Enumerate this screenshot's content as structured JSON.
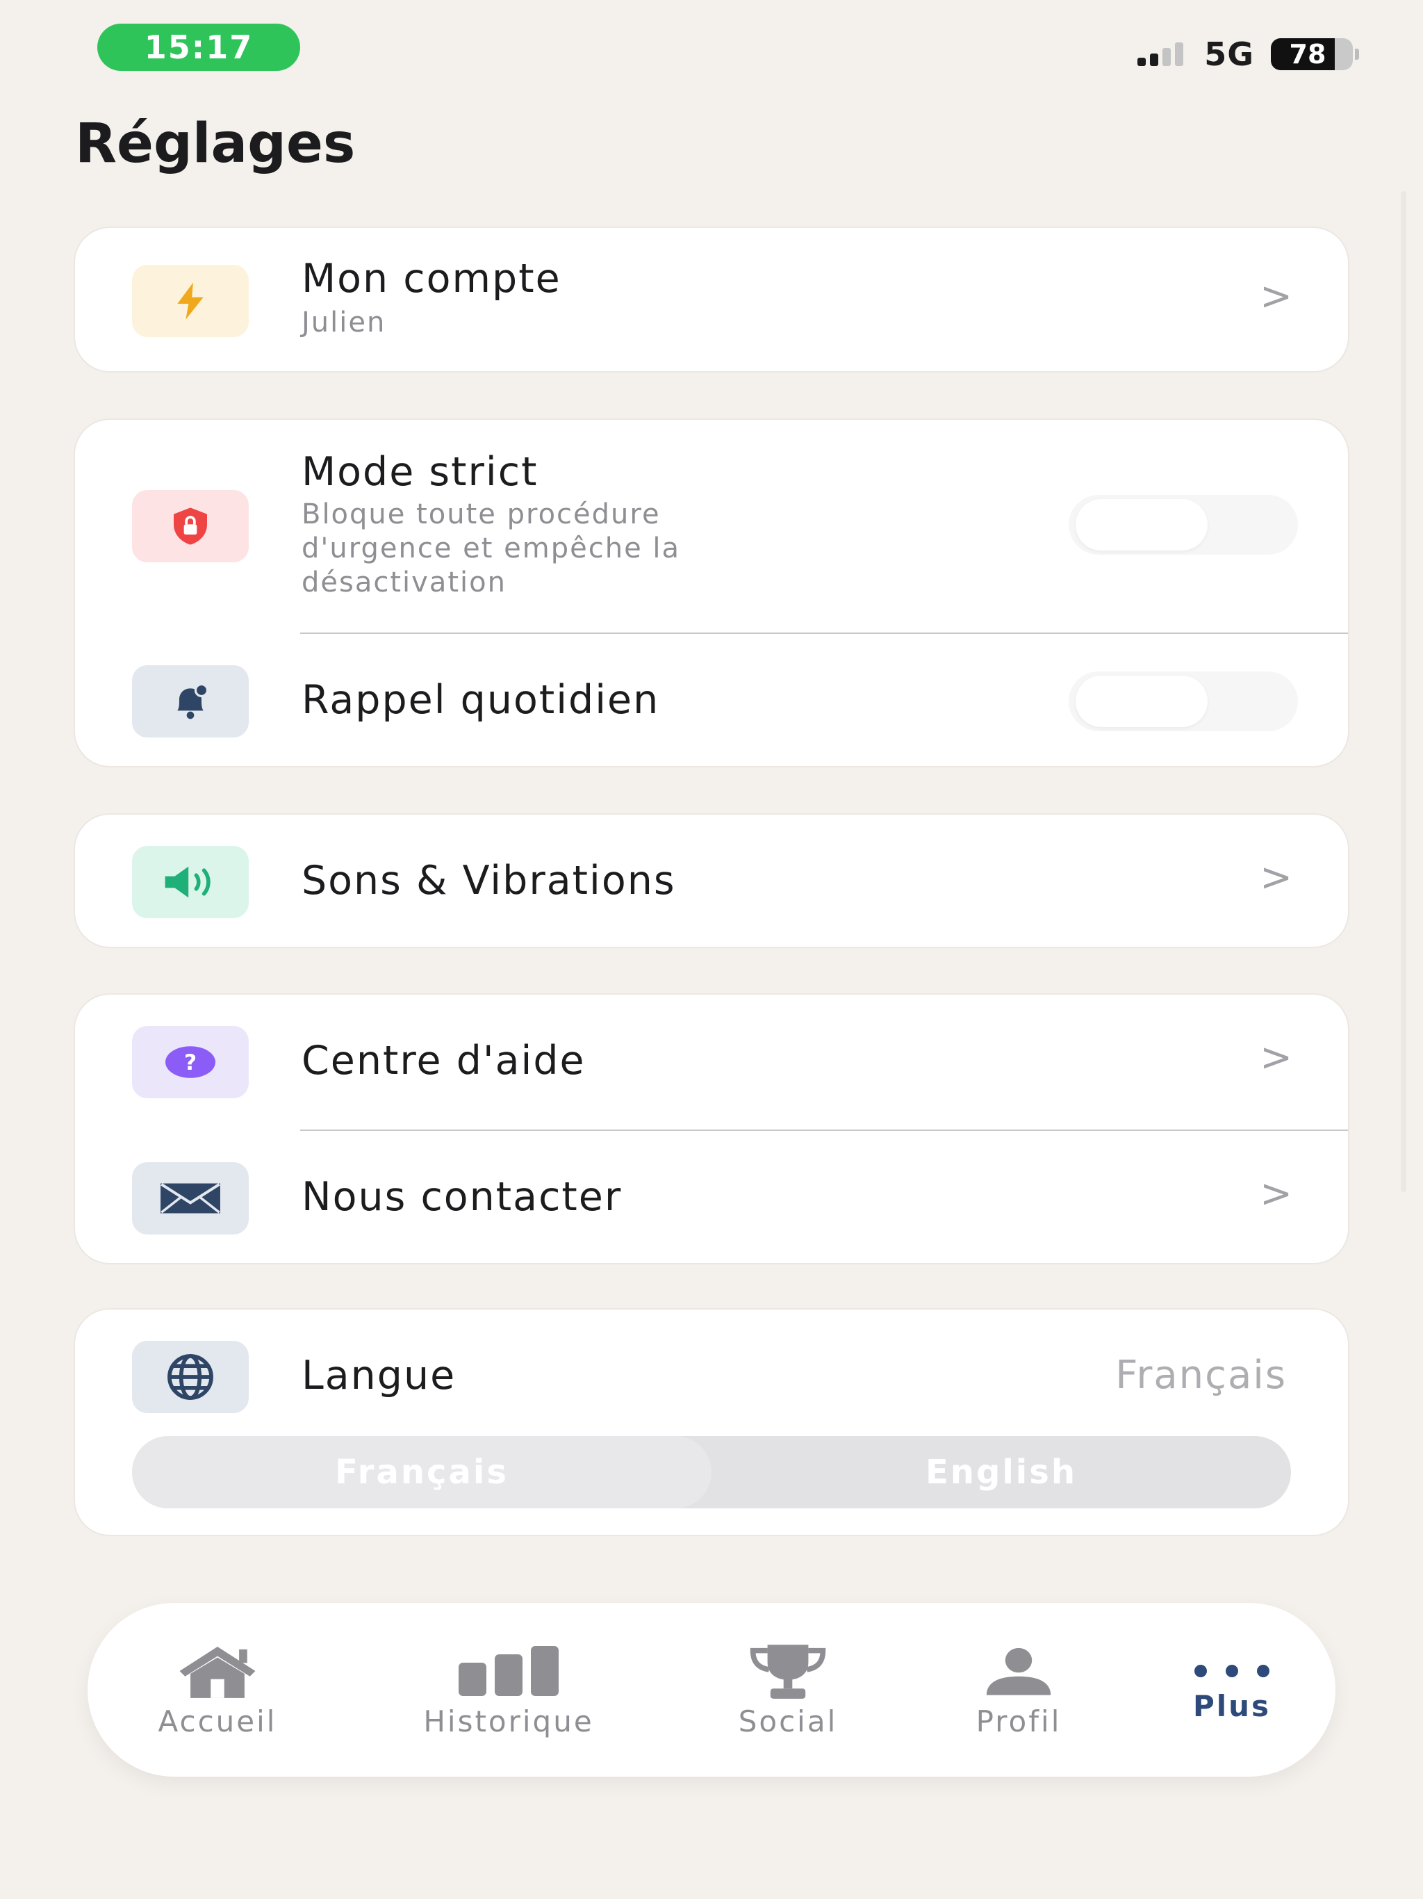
{
  "status_bar": {
    "time": "15:17",
    "network": "5G",
    "battery_percent": "78",
    "time_pill_color": "#2fc45a"
  },
  "page": {
    "title": "Réglages"
  },
  "sections": {
    "account": {
      "title": "Mon compte",
      "subtitle": "Julien",
      "icon": "bolt-icon",
      "icon_bg": "#fdf3dd"
    },
    "strict_mode": {
      "title": "Mode strict",
      "subtitle_lines": [
        "Bloque toute procédure",
        "d'urgence et empêche la",
        "désactivation"
      ],
      "icon": "shield-lock-icon",
      "icon_bg": "#fde3e3",
      "enabled": false
    },
    "daily_reminder": {
      "title": "Rappel quotidien",
      "icon": "bell-icon",
      "icon_bg": "#e3e8ef",
      "enabled": false
    },
    "sounds": {
      "title": "Sons & Vibrations",
      "icon": "speaker-icon",
      "icon_bg": "#dcf5ea"
    },
    "help": {
      "title": "Centre d'aide",
      "icon": "question-icon",
      "icon_bg": "#ece6fb"
    },
    "contact": {
      "title": "Nous contacter",
      "icon": "envelope-icon",
      "icon_bg": "#e3e8ef"
    },
    "language": {
      "title": "Langue",
      "value": "Français",
      "icon": "globe-icon",
      "icon_bg": "#e3e8ef",
      "options": [
        "Français",
        "English"
      ],
      "selected": "Français"
    }
  },
  "chevron": ">",
  "tabbar": {
    "tabs": [
      {
        "label": "Accueil",
        "icon": "home-icon"
      },
      {
        "label": "Historique",
        "icon": "bar-chart-icon"
      },
      {
        "label": "Social",
        "icon": "trophy-icon"
      },
      {
        "label": "Profil",
        "icon": "person-icon"
      },
      {
        "label": "Plus",
        "icon": "more-dots-icon"
      }
    ],
    "active": "Plus",
    "active_color": "#2e4a7a",
    "inactive_color": "#8e8e93"
  }
}
